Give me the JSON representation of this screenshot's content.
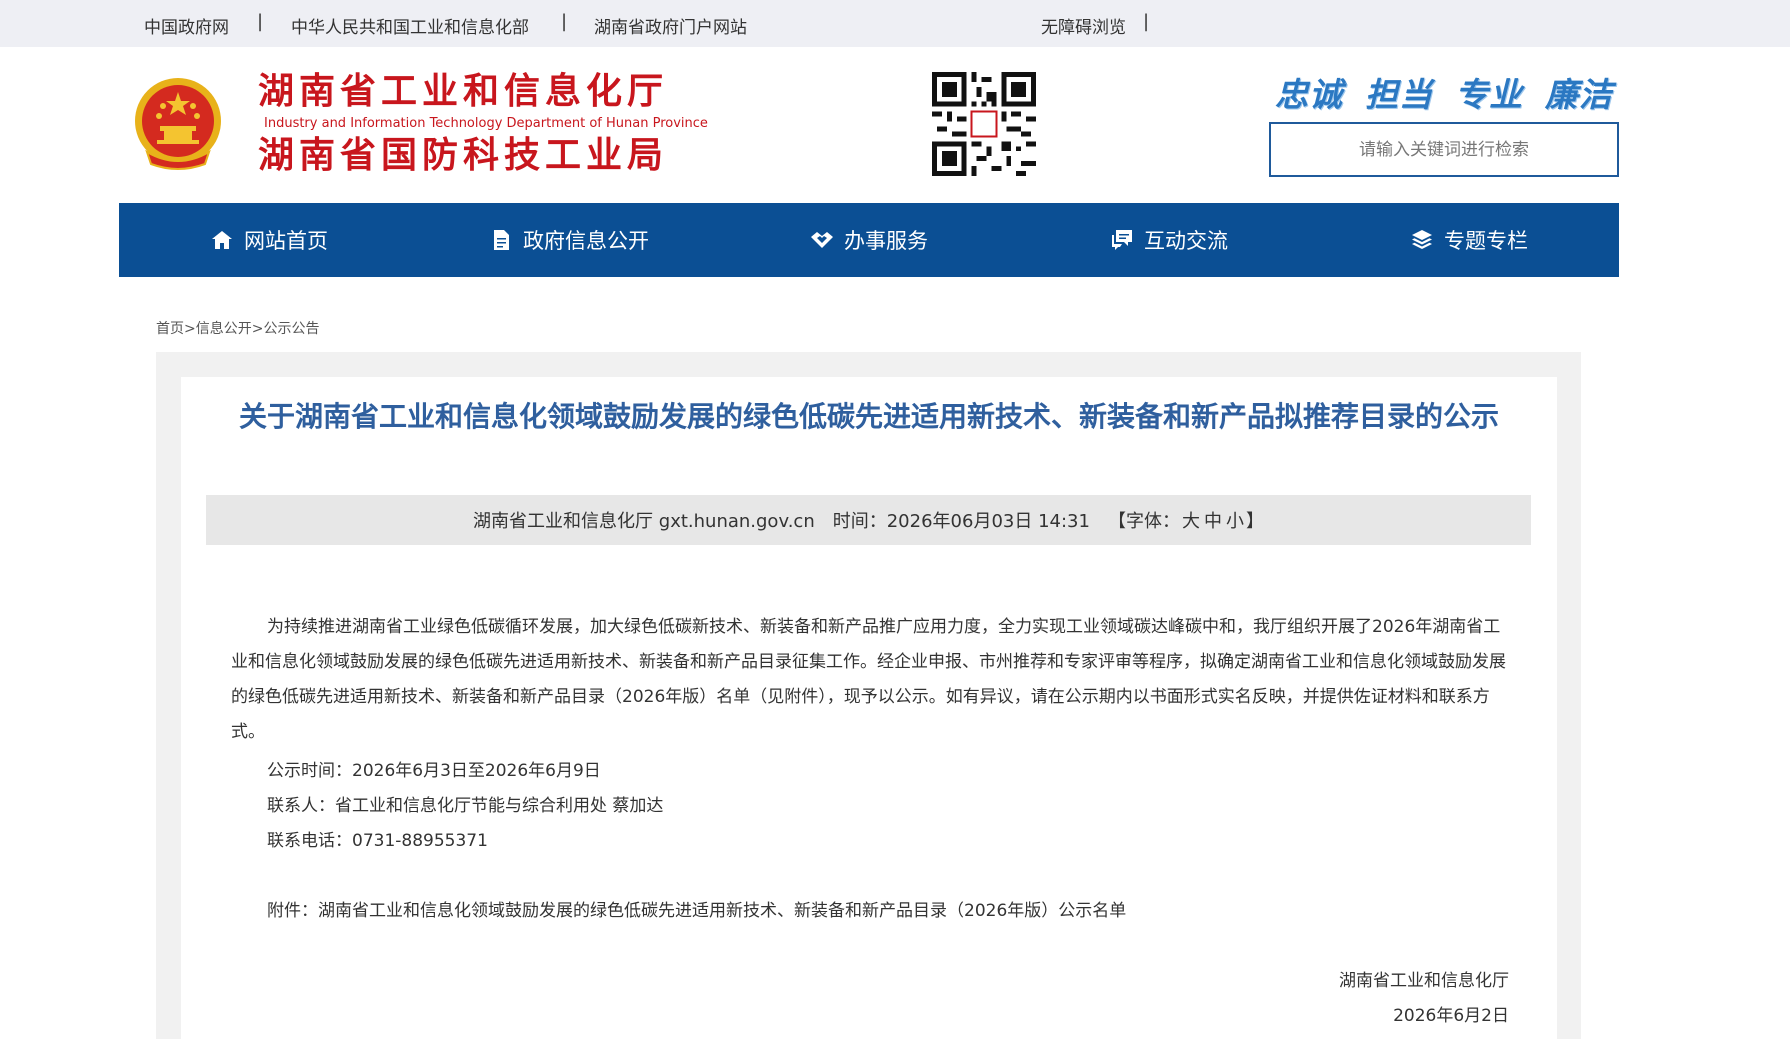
{
  "topbar": {
    "links": [
      "中国政府网",
      "中华人民共和国工业和信息化部",
      "湖南省政府门户网站"
    ],
    "accessibility": "无障碍浏览",
    "separator": "|"
  },
  "header": {
    "title_line1": "湖南省工业和信息化厅",
    "title_en": "Industry and Information Technology Department of Hunan Province",
    "title_line2": "湖南省国防科技工业局",
    "slogans": [
      "忠诚",
      "担当",
      "专业",
      "廉洁"
    ],
    "search_placeholder": "请输入关键词进行检索"
  },
  "nav": {
    "items": [
      {
        "label": "网站首页",
        "icon": "home-icon"
      },
      {
        "label": "政府信息公开",
        "icon": "document-icon"
      },
      {
        "label": "办事服务",
        "icon": "handshake-icon"
      },
      {
        "label": "互动交流",
        "icon": "chat-icon"
      },
      {
        "label": "专题专栏",
        "icon": "layers-icon"
      }
    ]
  },
  "breadcrumb": {
    "items": [
      "首页",
      "信息公开",
      "公示公告"
    ],
    "separator": ">"
  },
  "article": {
    "title": "关于湖南省工业和信息化领域鼓励发展的绿色低碳先进适用新技术、新装备和新产品拟推荐目录的公示",
    "meta_source": "湖南省工业和信息化厅 gxt.hunan.gov.cn",
    "meta_time": "时间：2026年06月03日 14:31",
    "meta_font_prefix": "【字体：",
    "meta_font_large": "大",
    "meta_font_medium": "中",
    "meta_font_small": "小",
    "meta_font_suffix": "】",
    "paragraph": "为持续推进湖南省工业绿色低碳循环发展，加大绿色低碳新技术、新装备和新产品推广应用力度，全力实现工业领域碳达峰碳中和，我厅组织开展了2026年湖南省工业和信息化领域鼓励发展的绿色低碳先进适用新技术、新装备和新产品目录征集工作。经企业申报、市州推荐和专家评审等程序，拟确定湖南省工业和信息化领域鼓励发展的绿色低碳先进适用新技术、新装备和新产品目录（2026年版）名单（见附件），现予以公示。如有异议，请在公示期内以书面形式实名反映，并提供佐证材料和联系方式。",
    "period": "公示时间：2026年6月3日至2026年6月9日",
    "contact": "联系人：省工业和信息化厅节能与综合利用处  蔡加达",
    "phone": "联系电话：0731-88955371",
    "attachment": "附件：湖南省工业和信息化领域鼓励发展的绿色低碳先进适用新技术、新装备和新产品目录（2026年版）公示名单",
    "signature_org": "湖南省工业和信息化厅",
    "signature_date": "2026年6月2日"
  },
  "colors": {
    "brand_red": "#c8161d",
    "nav_blue": "#0b4f94",
    "title_blue": "#2f5f9e",
    "slogan_blue": "#2b78c2"
  }
}
